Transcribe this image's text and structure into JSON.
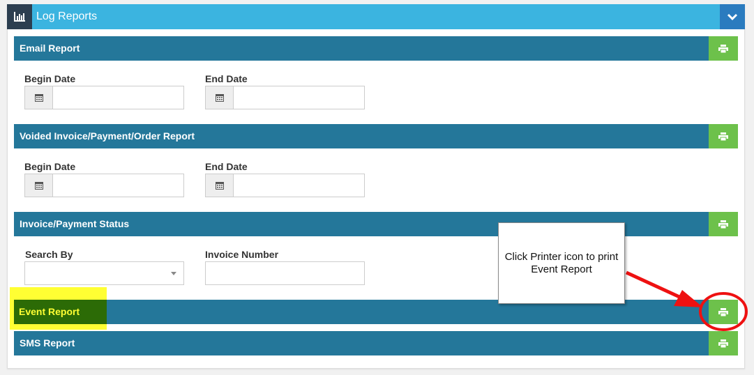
{
  "header": {
    "title": "Log Reports",
    "icon": "bar-chart-icon",
    "collapse_icon": "chevron-down-icon",
    "bg_color": "#3bb4e0"
  },
  "sections": {
    "email": {
      "label": "Email Report",
      "begin_label": "Begin Date",
      "end_label": "End Date",
      "begin_value": "",
      "end_value": ""
    },
    "voided": {
      "label": "Voided Invoice/Payment/Order Report",
      "begin_label": "Begin Date",
      "end_label": "End Date",
      "begin_value": "",
      "end_value": ""
    },
    "status": {
      "label": "Invoice/Payment Status",
      "search_by_label": "Search By",
      "search_by_value": "",
      "invoice_label": "Invoice Number",
      "invoice_value": ""
    },
    "event": {
      "label": "Event Report"
    },
    "sms": {
      "label": "SMS Report"
    }
  },
  "callout": {
    "line1": "Click Printer icon to print",
    "line2": "Event Report"
  },
  "colors": {
    "section_bar": "#24779a",
    "print_button": "#6dc14b",
    "highlight": "#ffff33",
    "annotation": "#ee1111"
  }
}
